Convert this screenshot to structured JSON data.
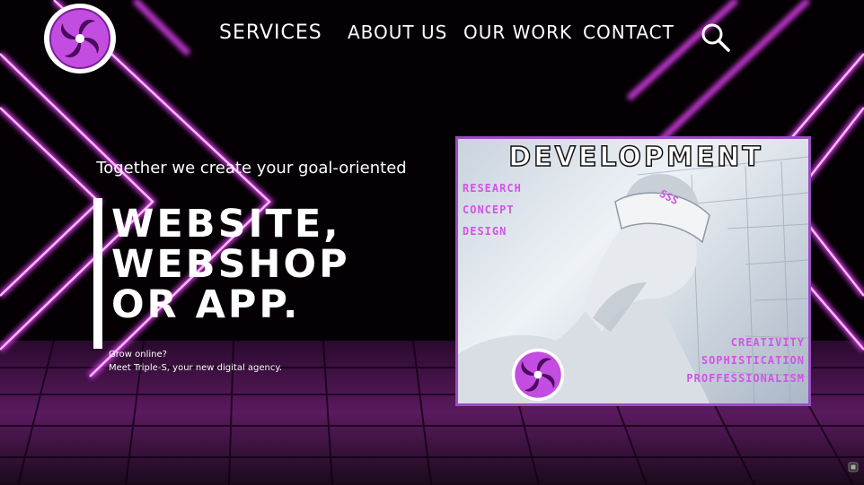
{
  "nav": {
    "services": "SERVICES",
    "about": "ABOUT US",
    "work": "OUR WORK",
    "contact": "CONTACT"
  },
  "hero": {
    "tagline": "Together we create your goal-oriented",
    "headline_line1": "WEBSITE,",
    "headline_line2": "WEBSHOP",
    "headline_line3": "OR APP.",
    "sub_line1": "Grow online?",
    "sub_line2": "Meet Triple-S, your new digital agency."
  },
  "card": {
    "title": "DEVELOPMENT",
    "left_tags": [
      "RESEARCH",
      "CONCEPT",
      "DESIGN"
    ],
    "right_tags": [
      "CREATIVITY",
      "SOPHISTICATION",
      "PROFFESSIONALISM"
    ],
    "badge": "SSS"
  },
  "colors": {
    "accent": "#c34de0",
    "card_border": "#9a4ec2",
    "background": "#050006"
  },
  "icons": {
    "logo": "triple-s-swirl-logo-icon",
    "search": "search-icon"
  }
}
